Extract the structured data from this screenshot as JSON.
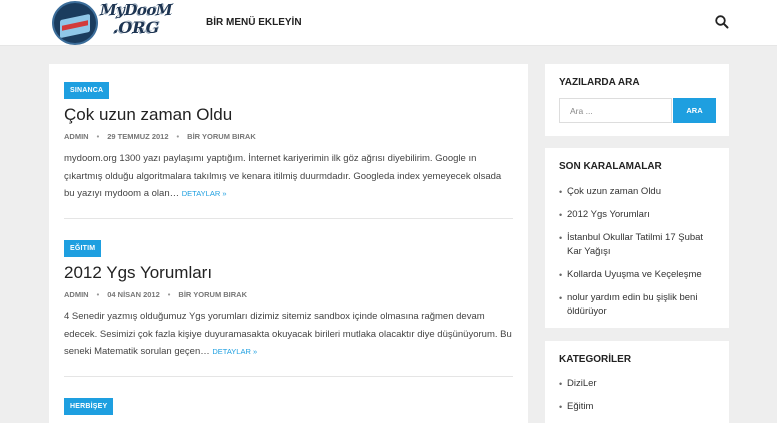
{
  "header": {
    "logo_line1": "MyDooM",
    "logo_line2": ".ORG",
    "nav_link": "BİR MENÜ EKLEYİN",
    "search_icon": "search-icon"
  },
  "posts": [
    {
      "category": "SINANCA",
      "title": "Çok uzun zaman Oldu",
      "author": "ADMIN",
      "date": "29 TEMMUZ 2012",
      "comments": "BİR YORUM BIRAK",
      "excerpt": "mydoom.org 1300 yazı paylaşımı yaptığım. İnternet kariyerimin ilk göz ağrısı diyebilirim. Google ın çıkartmış olduğu algoritmalara takılmış ve kenara itilmiş duurmdadır. Googleda index yemeyecek olsada bu yazıyı mydoom a olan…",
      "more": "DETAYLAR »"
    },
    {
      "category": "EĞITIM",
      "title": "2012 Ygs Yorumları",
      "author": "ADMIN",
      "date": "04 NİSAN 2012",
      "comments": "BİR YORUM BIRAK",
      "excerpt": "4 Senedir yazmış olduğumuz Ygs yorumları dizimiz sitemiz sandbox içinde olmasına rağmen devam edecek. Sesimizi çok fazla kişiye duyuramasakta okuyacak birileri mutlaka olacaktır diye düşünüyorum. Bu seneki Matematik sorulan geçen…",
      "more": "DETAYLAR »"
    },
    {
      "category": "HERBİŞEY"
    }
  ],
  "sidebar": {
    "search": {
      "title": "YAZILARDA ARA",
      "placeholder": "Ara ...",
      "button": "ARA"
    },
    "recent": {
      "title": "SON KARALAMALAR",
      "items": [
        "Çok uzun zaman Oldu",
        "2012 Ygs Yorumları",
        "İstanbul Okullar Tatilmi 17 Şubat Kar Yağışı",
        "Kollarda Uyuşma ve Keçeleşme",
        "nolur yardım edin bu şişlik beni öldürüyor"
      ]
    },
    "categories": {
      "title": "KATEGORİLER",
      "items": [
        "DiziLer",
        "Eğitim"
      ]
    }
  },
  "colors": {
    "accent": "#1e9fe0",
    "background": "#eeeeee"
  }
}
